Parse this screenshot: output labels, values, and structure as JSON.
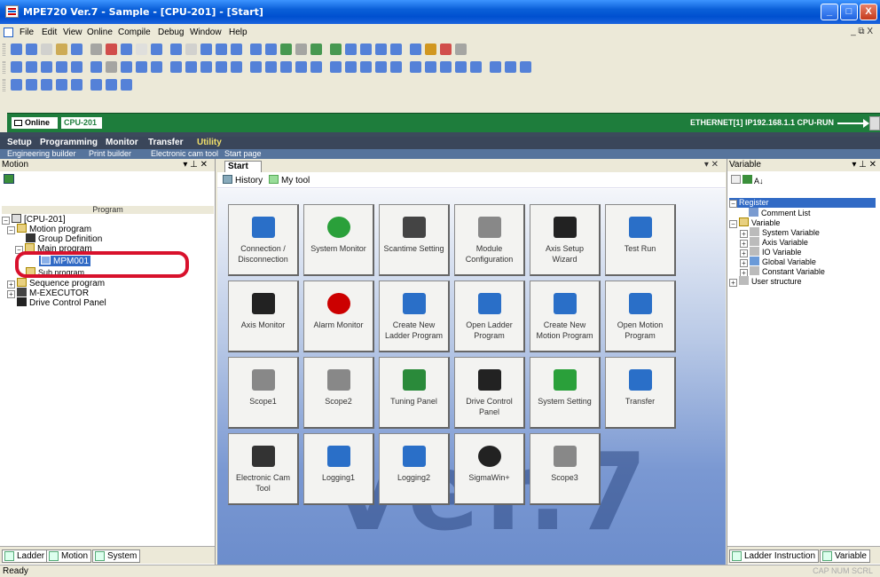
{
  "window": {
    "title": "MPE720 Ver.7 - Sample - [CPU-201] - [Start]",
    "min": "_",
    "max": "□",
    "close": "X",
    "mdi_controls": "_ ⧉ X"
  },
  "menu": [
    "File",
    "Edit",
    "View",
    "Online",
    "Compile",
    "Debug",
    "Window",
    "Help"
  ],
  "status_strip": {
    "online": "Online",
    "cpu": "CPU-201",
    "connection": "ETHERNET[1] IP192.168.1.1 CPU-RUN"
  },
  "main_tabs": [
    "Setup",
    "Programming",
    "Monitor",
    "Transfer",
    "Utility"
  ],
  "sub_tabs": [
    "Engineering builder",
    "Print builder",
    "Electronic cam tool",
    "Start page"
  ],
  "left_panel": {
    "title": "Motion",
    "controls": "▾ ⊥ ✕",
    "header": "Program",
    "tree": [
      "[CPU-201]",
      "Motion program",
      "Group Definition",
      "Main program",
      "MPM001",
      "Sub program",
      "Sequence program",
      "M-EXECUTOR",
      "Drive Control Panel"
    ],
    "bottom_tabs": [
      "Ladder",
      "Motion",
      "System"
    ]
  },
  "center": {
    "tab": "Start",
    "close": "▾ ✕",
    "history": "History",
    "mytool": "My tool",
    "watermark": "ver.7",
    "tiles": [
      "Connection / Disconnection",
      "System Monitor",
      "Scantime Setting",
      "Module Configuration",
      "Axis Setup Wizard",
      "Test Run",
      "Axis Monitor",
      "Alarm Monitor",
      "Create New Ladder Program",
      "Open Ladder Program",
      "Create New Motion Program",
      "Open Motion Program",
      "Scope1",
      "Scope2",
      "Tuning Panel",
      "Drive Control Panel",
      "System Setting",
      "Transfer",
      "Electronic Cam Tool",
      "Logging1",
      "Logging2",
      "SigmaWin+",
      "Scope3"
    ]
  },
  "right_panel": {
    "title": "Variable",
    "controls": "▾ ⊥ ✕",
    "sort": "A↓",
    "tree": [
      "Register",
      "Comment List",
      "Variable",
      "System Variable",
      "Axis Variable",
      "IO Variable",
      "Global Variable",
      "Constant Variable",
      "User structure"
    ],
    "bottom_tabs": [
      "Ladder Instruction",
      "Variable"
    ]
  },
  "status": {
    "left": "Ready",
    "right": "CAP NUM SCRL"
  }
}
